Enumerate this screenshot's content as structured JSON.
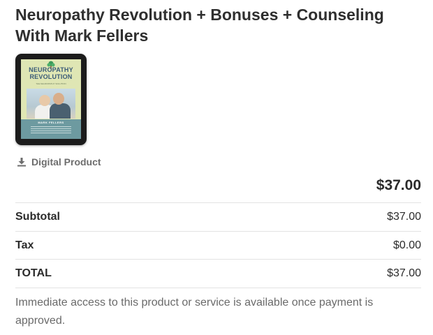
{
  "product": {
    "title": "Neuropathy Revolution + Bonuses + Counseling With Mark Fellers",
    "cover": {
      "title_line1": "NEUROPATHY",
      "title_line2": "REVOLUTION",
      "subtitle": "THE NEUROPATHY SOLUTION",
      "author": "MARK FELLERS"
    },
    "type_label": "Digital Product",
    "price": "$37.00"
  },
  "summary": {
    "rows": [
      {
        "label": "Subtotal",
        "value": "$37.00"
      },
      {
        "label": "Tax",
        "value": "$0.00"
      },
      {
        "label": "TOTAL",
        "value": "$37.00"
      }
    ]
  },
  "note": "Immediate access to this product or service is available once payment is approved.",
  "colors": {
    "text": "#2b2b2b",
    "muted": "#6a6a6a",
    "divider": "#e3e3e3"
  },
  "icons": {
    "download": "download-icon"
  }
}
